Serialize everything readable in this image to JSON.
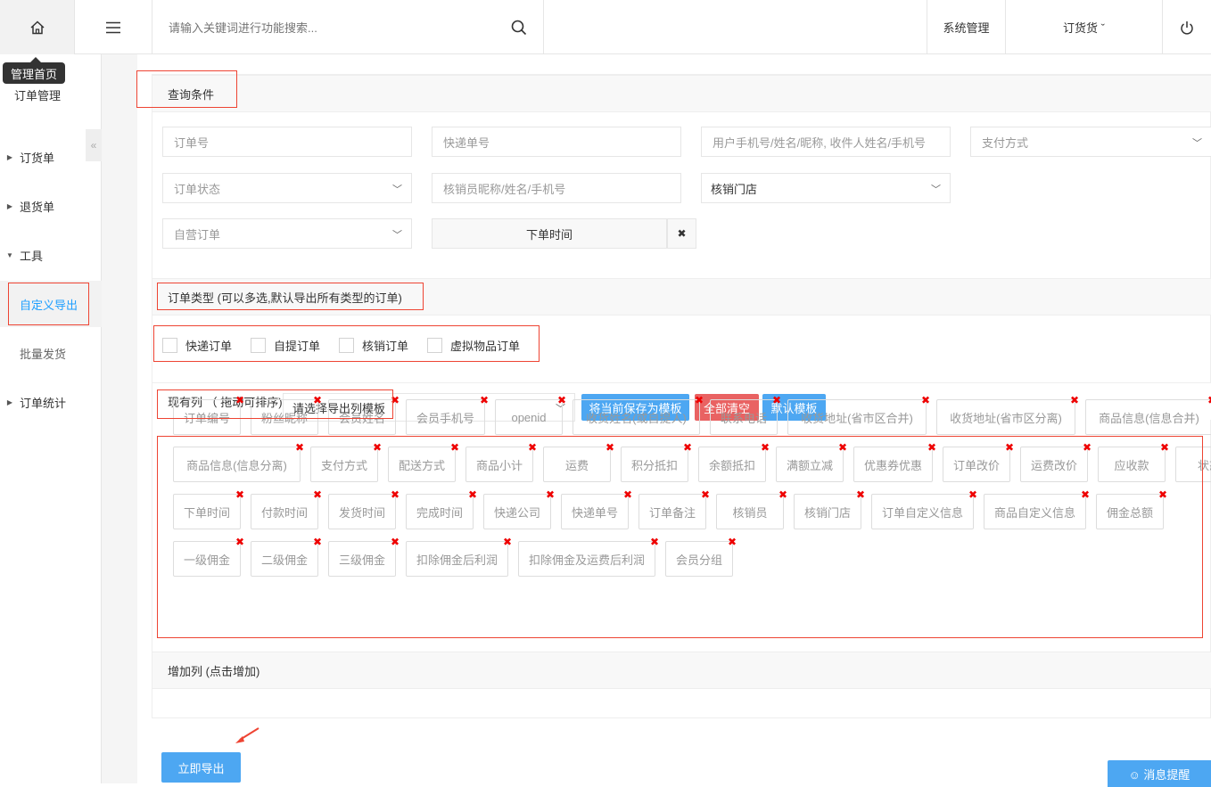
{
  "header": {
    "search_placeholder": "请输入关键词进行功能搜索...",
    "nav": [
      "系统管理",
      "订货货 ˇ"
    ],
    "tooltip": "管理首页"
  },
  "sidebar": {
    "title": "订单管理",
    "collapse": "«",
    "items": [
      {
        "label": "订货单",
        "expanded": false
      },
      {
        "label": "退货单",
        "expanded": false
      },
      {
        "label": "工具",
        "expanded": true
      },
      {
        "label": "自定义导出",
        "active": true
      },
      {
        "label": "批量发货"
      },
      {
        "label": "订单统计",
        "expanded": false
      }
    ]
  },
  "query": {
    "title": "查询条件",
    "fields": {
      "order_no": "订单号",
      "express_no": "快递单号",
      "user": "用户手机号/姓名/昵称, 收件人姓名/手机号",
      "pay": "支付方式",
      "status": "订单状态",
      "verifier": "核销员昵称/姓名/手机号",
      "store": "核销门店",
      "self_order": "自营订单",
      "order_time": "下单时间"
    },
    "clear": "✖"
  },
  "order_type": {
    "title": "订单类型 (可以多选,默认导出所有类型的订单)",
    "options": [
      "快递订单",
      "自提订单",
      "核销订单",
      "虚拟物品订单"
    ]
  },
  "columns": {
    "title": "现有列 （ 拖动可排序)",
    "template_select": "请选择导出列模板",
    "save_btn": "将当前保存为模板",
    "clear_btn": "全部清空",
    "default_btn": "默认模板",
    "tags": [
      [
        "订单编号",
        "粉丝昵称",
        "会员姓名",
        "会员手机号",
        "openid",
        "收货姓名(或自提人)",
        "联系电话",
        "收货地址(省市区合并)",
        "收货地址(省市区分离)",
        "商品信息(信息合并)"
      ],
      [
        "商品信息(信息分离)",
        "支付方式",
        "配送方式",
        "商品小计",
        "运费",
        "积分抵扣",
        "余额抵扣",
        "满额立减",
        "优惠券优惠",
        "订单改价",
        "运费改价",
        "应收款",
        "状态"
      ],
      [
        "下单时间",
        "付款时间",
        "发货时间",
        "完成时间",
        "快递公司",
        "快递单号",
        "订单备注",
        "核销员",
        "核销门店",
        "订单自定义信息",
        "商品自定义信息",
        "佣金总额"
      ],
      [
        "一级佣金",
        "二级佣金",
        "三级佣金",
        "扣除佣金后利润",
        "扣除佣金及运费后利润",
        "会员分组"
      ]
    ],
    "remove": "✖"
  },
  "add_columns": {
    "title": "增加列 (点击增加)"
  },
  "export_btn": "立即导出",
  "message_btn": "☺ 消息提醒",
  "colors": {
    "blue": "#4da7f2",
    "red": "#e96262",
    "active": "#1e9fff",
    "mark": "#e43"
  }
}
